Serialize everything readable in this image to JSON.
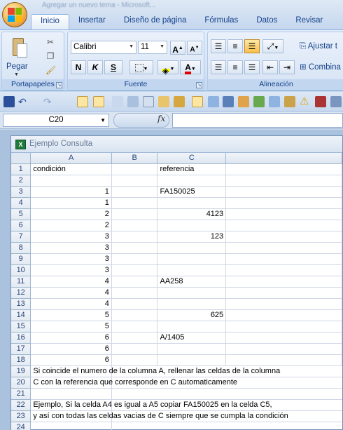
{
  "window": {
    "doc_title": "Agregar un nuevo tema - Microsoft...",
    "tabs": [
      "Inicio",
      "Insertar",
      "Diseño de página",
      "Fórmulas",
      "Datos",
      "Revisar"
    ],
    "active_tab": "Inicio"
  },
  "ribbon": {
    "clipboard": {
      "paste_label": "Pegar",
      "group_label": "Portapapeles"
    },
    "font": {
      "name": "Calibri",
      "size": "11",
      "bold": "N",
      "italic": "K",
      "underline": "S",
      "group_label": "Fuente"
    },
    "alignment": {
      "wrap_label": "Ajustar t",
      "merge_label": "Combina",
      "group_label": "Alineación"
    }
  },
  "formula_bar": {
    "name_box": "C20",
    "fx_label": "fx",
    "value": ""
  },
  "workbook": {
    "title": "Ejemplo Consulta",
    "columns": [
      "A",
      "B",
      "C"
    ],
    "rows": [
      {
        "n": "1",
        "a": "condición",
        "b": "",
        "c": "referencia",
        "a_num": false,
        "c_num": false
      },
      {
        "n": "2",
        "a": "",
        "b": "",
        "c": "",
        "a_num": true,
        "c_num": false
      },
      {
        "n": "3",
        "a": "1",
        "b": "",
        "c": "FA150025",
        "a_num": true,
        "c_num": false
      },
      {
        "n": "4",
        "a": "1",
        "b": "",
        "c": "",
        "a_num": true,
        "c_num": false
      },
      {
        "n": "5",
        "a": "2",
        "b": "",
        "c": "4123",
        "a_num": true,
        "c_num": true
      },
      {
        "n": "6",
        "a": "2",
        "b": "",
        "c": "",
        "a_num": true,
        "c_num": false
      },
      {
        "n": "7",
        "a": "3",
        "b": "",
        "c": "123",
        "a_num": true,
        "c_num": true
      },
      {
        "n": "8",
        "a": "3",
        "b": "",
        "c": "",
        "a_num": true,
        "c_num": false
      },
      {
        "n": "9",
        "a": "3",
        "b": "",
        "c": "",
        "a_num": true,
        "c_num": false
      },
      {
        "n": "10",
        "a": "3",
        "b": "",
        "c": "",
        "a_num": true,
        "c_num": false
      },
      {
        "n": "11",
        "a": "4",
        "b": "",
        "c": "AA258",
        "a_num": true,
        "c_num": false
      },
      {
        "n": "12",
        "a": "4",
        "b": "",
        "c": "",
        "a_num": true,
        "c_num": false
      },
      {
        "n": "13",
        "a": "4",
        "b": "",
        "c": "",
        "a_num": true,
        "c_num": false
      },
      {
        "n": "14",
        "a": "5",
        "b": "",
        "c": "625",
        "a_num": true,
        "c_num": true
      },
      {
        "n": "15",
        "a": "5",
        "b": "",
        "c": "",
        "a_num": true,
        "c_num": false
      },
      {
        "n": "16",
        "a": "6",
        "b": "",
        "c": "A/1405",
        "a_num": true,
        "c_num": false
      },
      {
        "n": "17",
        "a": "6",
        "b": "",
        "c": "",
        "a_num": true,
        "c_num": false
      },
      {
        "n": "18",
        "a": "6",
        "b": "",
        "c": "",
        "a_num": true,
        "c_num": false
      }
    ],
    "text_rows": [
      {
        "n": "19",
        "text": "Si coincide el numero  de la columna A, rellenar las celdas de la columna"
      },
      {
        "n": "20",
        "text": " C con la referencia  que corresponde en C automaticamente"
      },
      {
        "n": "21",
        "text": ""
      },
      {
        "n": "22",
        "text": "Ejemplo, Si la celda A4 es igual a A5  copiar FA150025 en la celda C5,"
      },
      {
        "n": "23",
        "text": " y así con todas las celdas vacias de C siempre que se cumpla la condición"
      },
      {
        "n": "24",
        "text": ""
      }
    ]
  }
}
